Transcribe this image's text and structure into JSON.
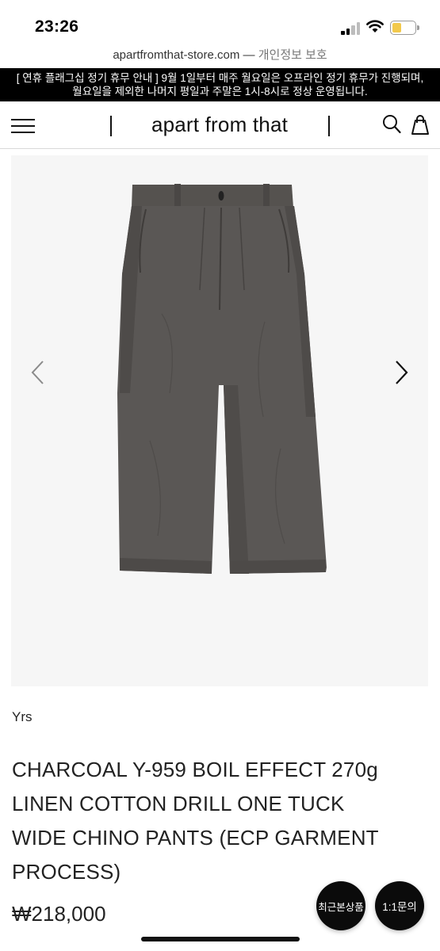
{
  "status_bar": {
    "time": "23:26",
    "icons": [
      "cellular-signal-icon",
      "wifi-icon",
      "battery-icon"
    ],
    "battery_color": "#f2c94c"
  },
  "browser": {
    "url": "apartfromthat-store.com",
    "separator": " — ",
    "privacy_label": "개인정보 보호"
  },
  "notice": {
    "line1": "[ 연휴 플래그십 정기 휴무 안내 ] 9월 1일부터 매주 월요일은 오프라인 정기 휴무가 진행되며,",
    "line2": "월요일을 제외한 나머지 평일과 주말은 1시-8시로 정상 운영됩니다."
  },
  "nav": {
    "brand": "apart from that",
    "icons": [
      "menu-icon",
      "search-icon",
      "shopping-bag-icon"
    ]
  },
  "gallery": {
    "image_subject": "charcoal wide chino pants",
    "icons": [
      "chevron-left-icon",
      "chevron-right-icon"
    ],
    "background_color": "#f6f6f6",
    "garment_color": "#595654"
  },
  "product": {
    "brand": "Yrs",
    "title_lines": [
      "CHARCOAL Y-959 BOIL EFFECT 270g",
      "LINEN COTTON DRILL ONE TUCK",
      "WIDE CHINO PANTS (ECP GARMENT",
      "PROCESS)"
    ],
    "price": "₩218,000"
  },
  "floating_buttons": {
    "recent": "최근본상품",
    "inquiry": "1:1문의"
  }
}
